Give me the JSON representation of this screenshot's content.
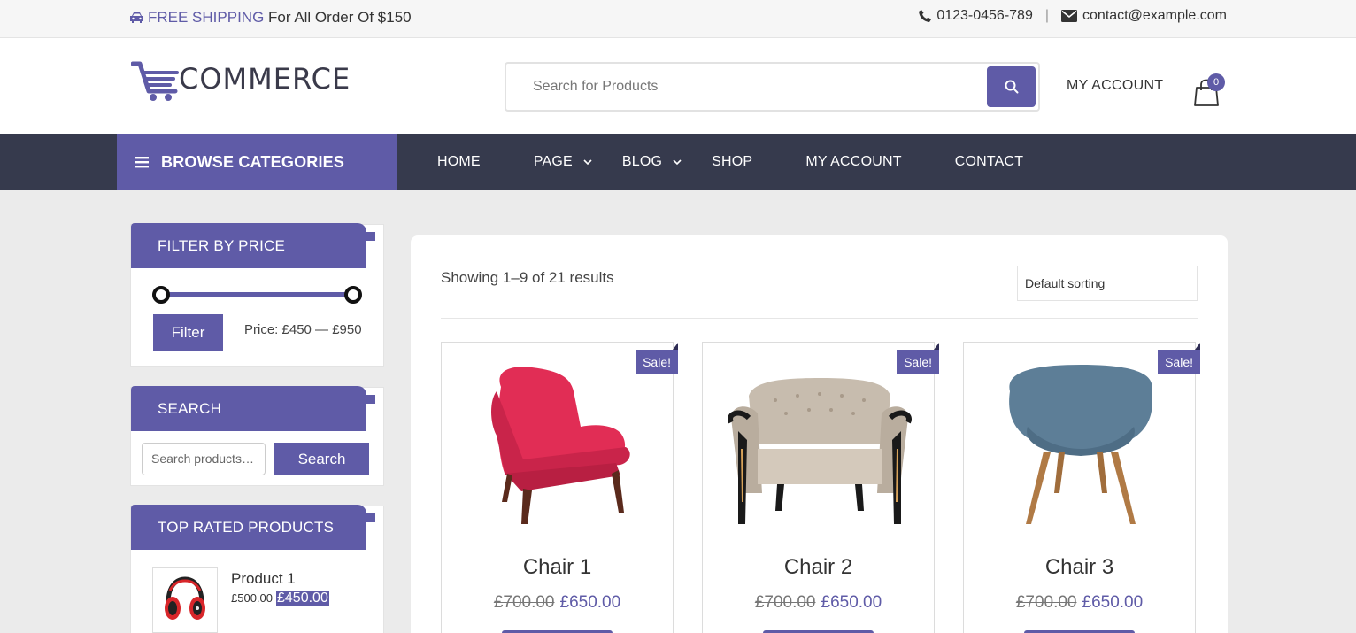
{
  "topbar": {
    "shipping_highlight": "FREE SHIPPING",
    "shipping_text": " For All Order Of $150",
    "phone": "0123-0456-789",
    "separator": "|",
    "email": "contact@example.com"
  },
  "header": {
    "logo_text": "COMMERCE",
    "search_placeholder": "Search for Products",
    "my_account": "MY ACCOUNT",
    "cart_count": "0"
  },
  "nav": {
    "browse_label": "BROWSE CATEGORIES",
    "items": [
      {
        "label": "HOME"
      },
      {
        "label": "PAGE"
      },
      {
        "label": "BLOG"
      },
      {
        "label": "SHOP"
      },
      {
        "label": "MY ACCOUNT"
      },
      {
        "label": "CONTACT"
      }
    ]
  },
  "sidebar": {
    "filter": {
      "title": "FILTER BY PRICE",
      "button": "Filter",
      "price_label": "Price: £450 — £950",
      "min_fraction": 0,
      "max_fraction": 1
    },
    "search": {
      "title": "SEARCH",
      "placeholder": "Search products…",
      "button": "Search"
    },
    "top_rated": {
      "title": "TOP RATED PRODUCTS",
      "items": [
        {
          "name": "Product 1",
          "old_price": "£500.00",
          "new_price": "£450.00"
        }
      ]
    }
  },
  "main": {
    "results_text": "Showing 1–9 of 21 results",
    "sorting": "Default sorting",
    "products": [
      {
        "name": "Chair 1",
        "old_price": "£700.00",
        "new_price": "£650.00",
        "badge": "Sale!"
      },
      {
        "name": "Chair 2",
        "old_price": "£700.00",
        "new_price": "£650.00",
        "badge": "Sale!"
      },
      {
        "name": "Chair 3",
        "old_price": "£700.00",
        "new_price": "£650.00",
        "badge": "Sale!"
      }
    ]
  },
  "colors": {
    "accent": "#5f5ba7",
    "nav_bg": "#363a4d",
    "page_bg": "#ebebeb"
  }
}
